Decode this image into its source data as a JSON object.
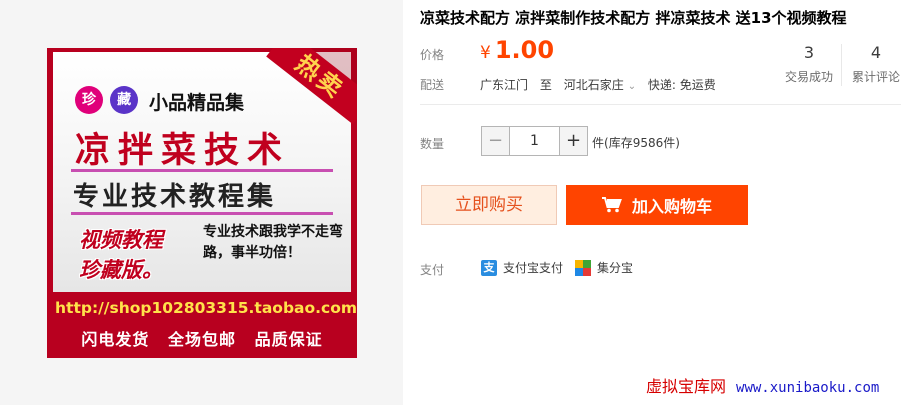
{
  "product": {
    "title": "凉菜技术配方 凉拌菜制作技术配方 拌凉菜技术 送13个视频教程"
  },
  "poster": {
    "ribbon": "热卖",
    "badge1": "珍",
    "badge2": "藏",
    "series": "小品精品集",
    "title1": "凉拌菜技术",
    "title2": "专业技术教程集",
    "video_line1": "视频教程",
    "video_line2": "珍藏版。",
    "pitch": "专业技术跟我学不走弯路，事半功倍！",
    "url": "http://shop102803315.taobao.com",
    "footer": "闪电发货 全场包邮 品质保证",
    "colors": {
      "frame": "#b8001f",
      "accent": "#c0001e",
      "url": "#ffe24a"
    }
  },
  "price": {
    "label": "价格",
    "currency": "¥",
    "value": "1.00",
    "color": "#ff4400"
  },
  "shipping": {
    "label": "配送",
    "from": "广东江门",
    "to_word": "至",
    "to": "河北石家庄",
    "method": "快递: 免运费"
  },
  "stats": [
    {
      "value": "3",
      "label": "交易成功"
    },
    {
      "value": "4",
      "label": "累计评论"
    }
  ],
  "quantity": {
    "label": "数量",
    "value": "1",
    "unit": "件",
    "stock": "(库存9586件)"
  },
  "actions": {
    "buy_now": "立即购买",
    "add_to_cart": "加入购物车"
  },
  "payment": {
    "label": "支付",
    "methods": [
      {
        "icon": "alipay-icon",
        "label": "支付宝支付"
      },
      {
        "icon": "jifenbao-icon",
        "label": "集分宝"
      }
    ]
  },
  "watermark": {
    "site": "虚拟宝库网",
    "url": "www.xunibaoku.com"
  }
}
